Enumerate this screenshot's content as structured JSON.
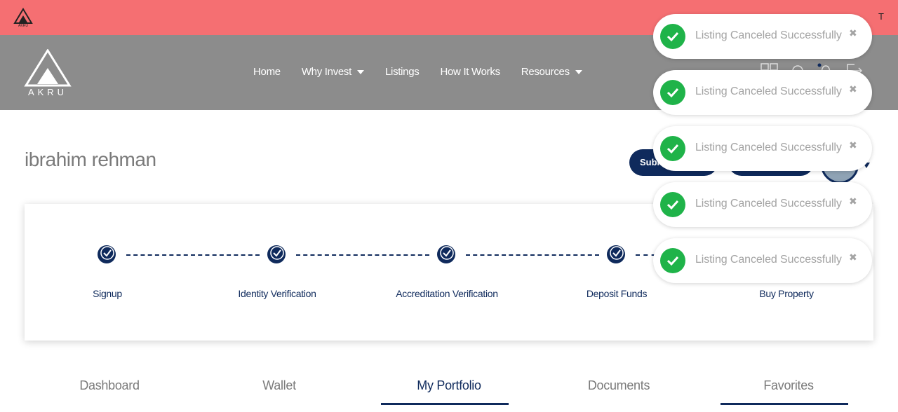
{
  "topbar": {
    "corner_char": "T"
  },
  "brand": {
    "name": "AKRU"
  },
  "nav": {
    "items": [
      {
        "label": "Home",
        "dropdown": false
      },
      {
        "label": "Why Invest",
        "dropdown": true
      },
      {
        "label": "Listings",
        "dropdown": false
      },
      {
        "label": "How It Works",
        "dropdown": false
      },
      {
        "label": "Resources",
        "dropdown": true
      }
    ]
  },
  "profile": {
    "name": "ibrahim rehman",
    "submit_button_label": "Subm"
  },
  "steps": [
    {
      "label": "Signup",
      "done": true
    },
    {
      "label": "Identity Verification",
      "done": true
    },
    {
      "label": "Accreditation Verification",
      "done": true
    },
    {
      "label": "Deposit Funds",
      "done": true
    },
    {
      "label": "Buy Property",
      "done": false
    }
  ],
  "tabs": [
    {
      "label": "Dashboard",
      "active": false
    },
    {
      "label": "Wallet",
      "active": false
    },
    {
      "label": "My Portfolio",
      "active": true
    },
    {
      "label": "Documents",
      "active": false
    },
    {
      "label": "Favorites",
      "active": false
    }
  ],
  "toasts": [
    {
      "message": "Listing Canceled Successfully",
      "close": "✖"
    },
    {
      "message": "Listing Canceled Successfully",
      "close": "✖"
    },
    {
      "message": "Listing Canceled Successfully",
      "close": "✖"
    },
    {
      "message": "Listing Canceled Successfully",
      "close": "✖"
    },
    {
      "message": "Listing Canceled Successfully",
      "close": "✖"
    }
  ],
  "colors": {
    "topbar": "#f56f72",
    "navbar": "#8c8c8c",
    "primary": "#0f2a5c",
    "success": "#1fb349"
  }
}
